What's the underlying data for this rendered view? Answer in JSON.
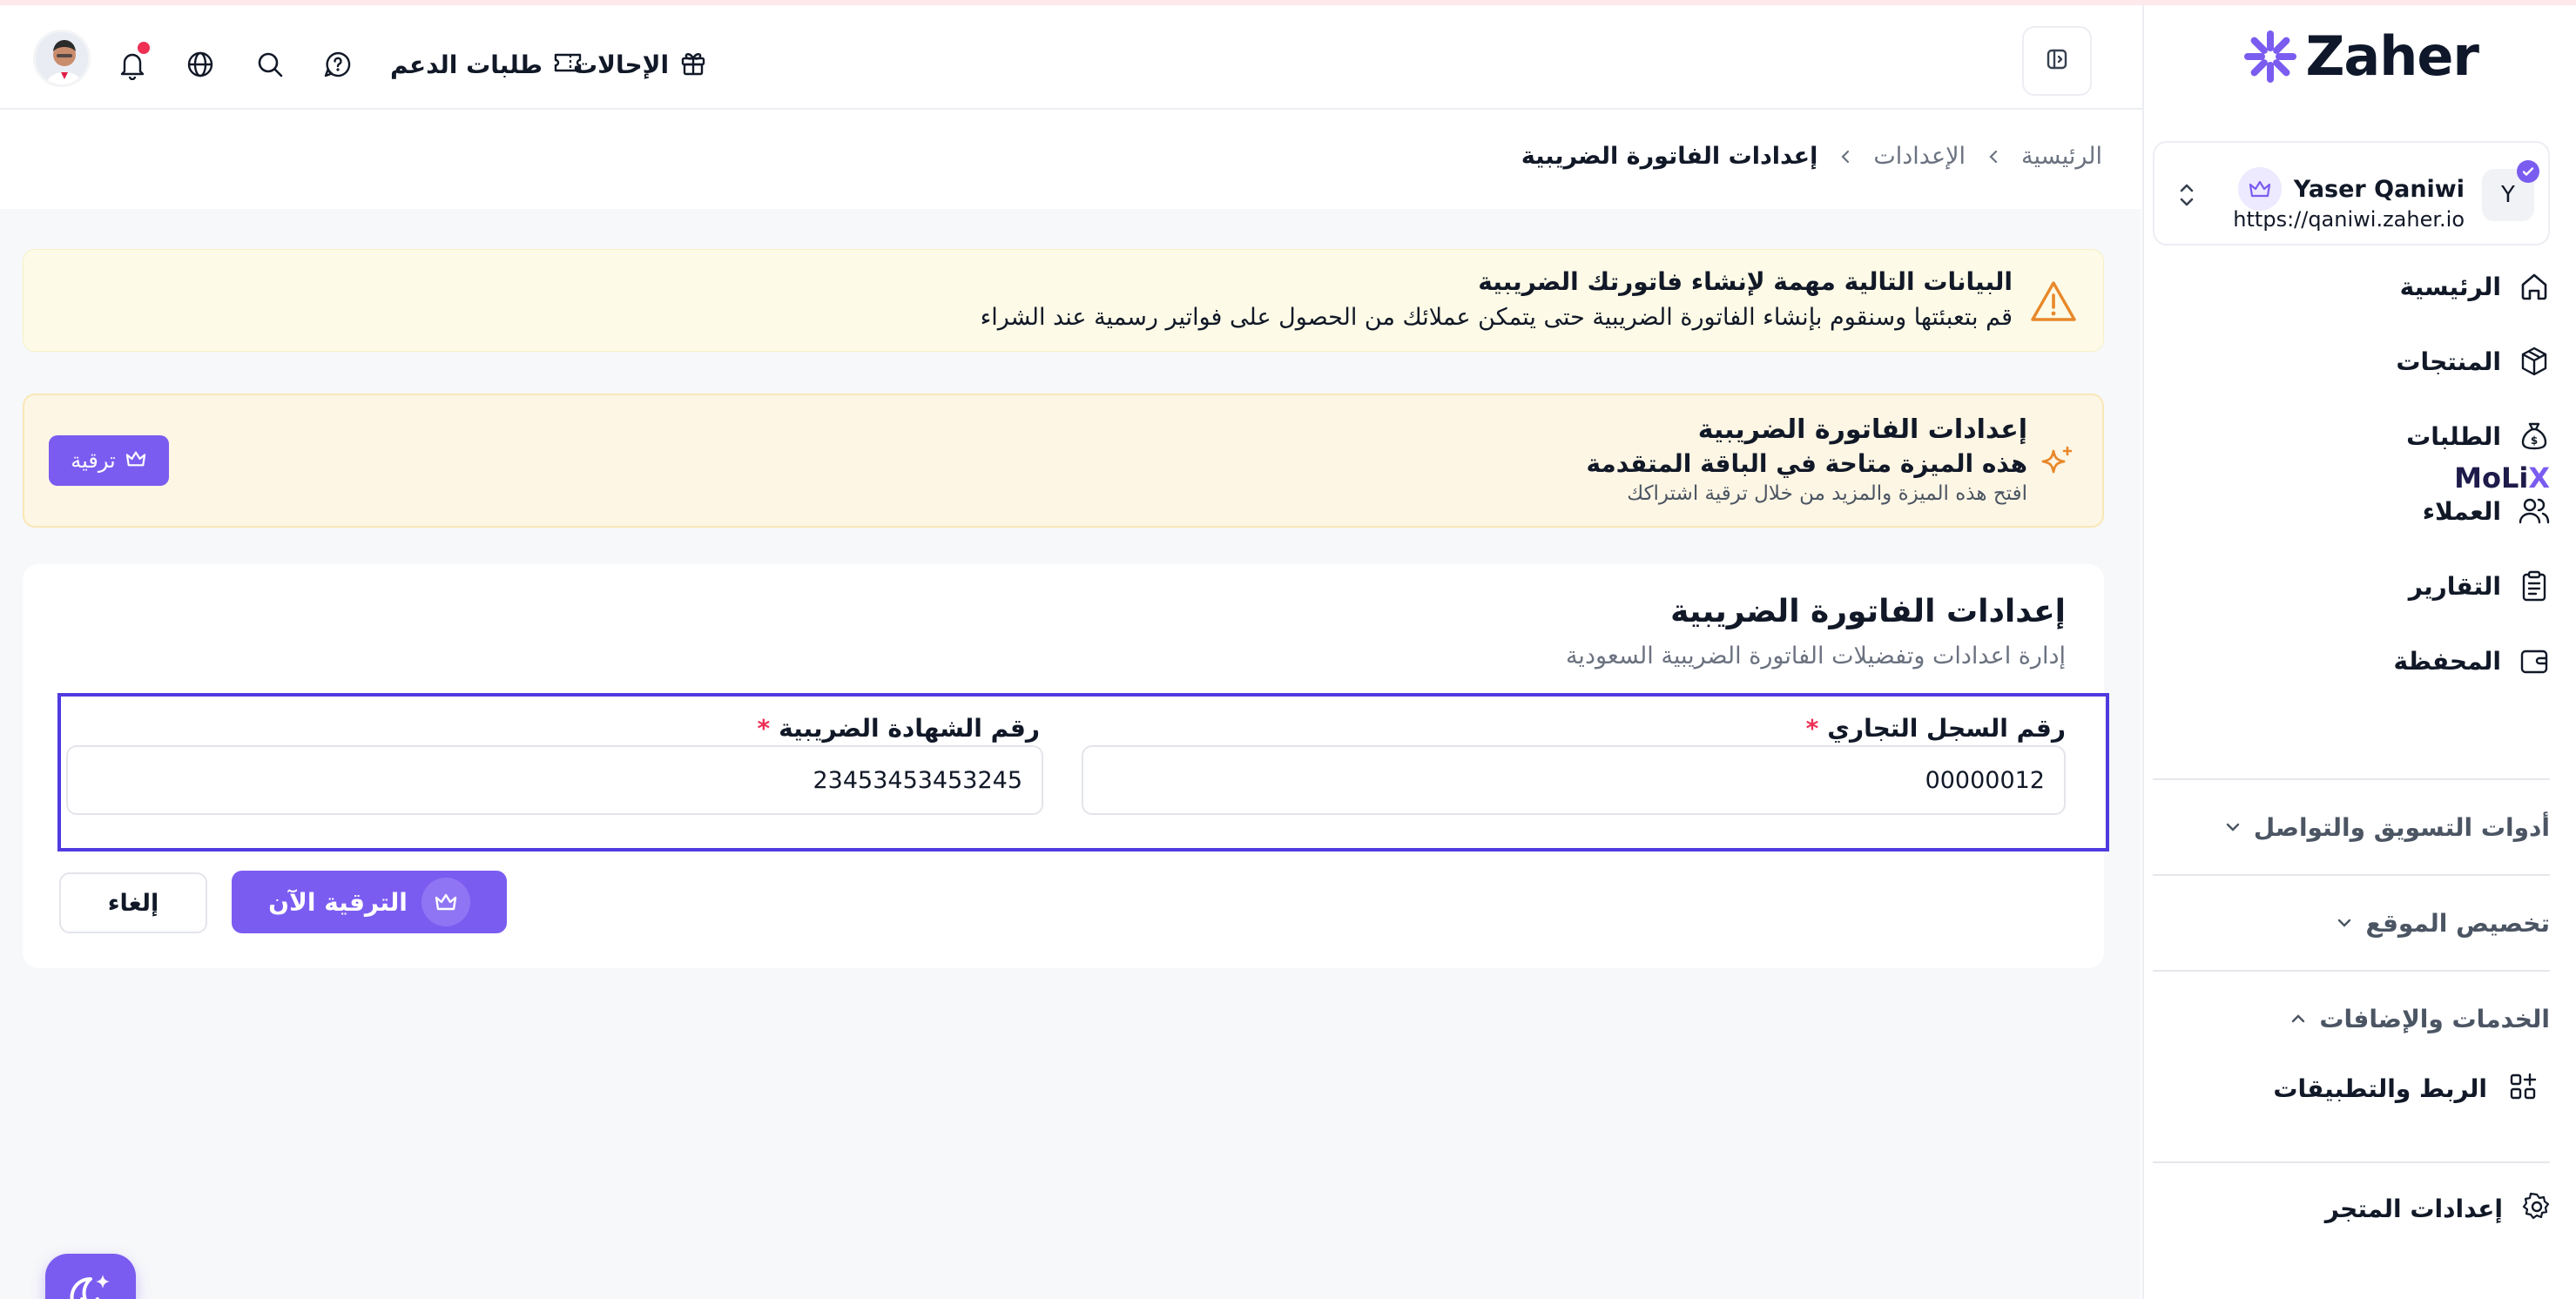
{
  "brand": {
    "name": "Zaher",
    "accent": "#7b5cf0"
  },
  "store": {
    "initial": "Y",
    "name": "Yaser Qaniwi",
    "url": "https://qaniwi.zaher.io"
  },
  "sidebar": {
    "items": [
      {
        "label": "الرئيسية",
        "icon": "home-icon"
      },
      {
        "label": "المنتجات",
        "icon": "box-icon"
      },
      {
        "label": "الطلبات",
        "icon": "money-bag-icon"
      },
      {
        "label": "العملاء",
        "icon": "users-icon"
      },
      {
        "label": "التقارير",
        "icon": "clipboard-icon"
      },
      {
        "label": "المحفظة",
        "icon": "wallet-icon"
      }
    ],
    "molix": {
      "main": "MoLi",
      "accent": "X"
    },
    "sections": [
      {
        "label": "أدوات التسويق والتواصل",
        "state": "collapsed"
      },
      {
        "label": "تخصيص الموقع",
        "state": "collapsed"
      },
      {
        "label": "الخدمات والإضافات",
        "state": "expanded"
      }
    ],
    "sub_items": [
      {
        "label": "الربط والتطبيقات",
        "icon": "apps-icon"
      }
    ],
    "store_settings": {
      "label": "إعدادات المتجر",
      "icon": "gear-icon"
    }
  },
  "topbar": {
    "referrals": "الإحالات",
    "support_tickets": "طلبات الدعم"
  },
  "breadcrumb": {
    "home": "الرئيسية",
    "settings": "الإعدادات",
    "current": "إعدادات الفاتورة الضريبية"
  },
  "alert": {
    "title": "البيانات التالية مهمة لإنشاء فاتورتك الضريبية",
    "desc": "قم بتعبئتها وسنقوم بإنشاء الفاتورة الضريبية حتى يتمكن عملائك من الحصول على فواتير رسمية عند الشراء"
  },
  "upsell": {
    "title": "إعدادات الفاتورة الضريبية",
    "subtitle": "هذه الميزة متاحة في الباقة المتقدمة",
    "hint": "افتح هذه الميزة والمزيد من خلال ترقية اشتراكك",
    "button": "ترقية"
  },
  "form": {
    "title": "إعدادات الفاتورة الضريبية",
    "subtitle": "إدارة اعدادات وتفضيلات الفاتورة الضريبية السعودية",
    "cr_label": "رقم السجل التجاري",
    "cr_value": "00000012",
    "tax_label": "رقم الشهادة الضريبية",
    "tax_value": "23453453453245",
    "required_mark": "*",
    "upgrade_button": "الترقية الآن",
    "cancel_button": "إلغاء"
  }
}
